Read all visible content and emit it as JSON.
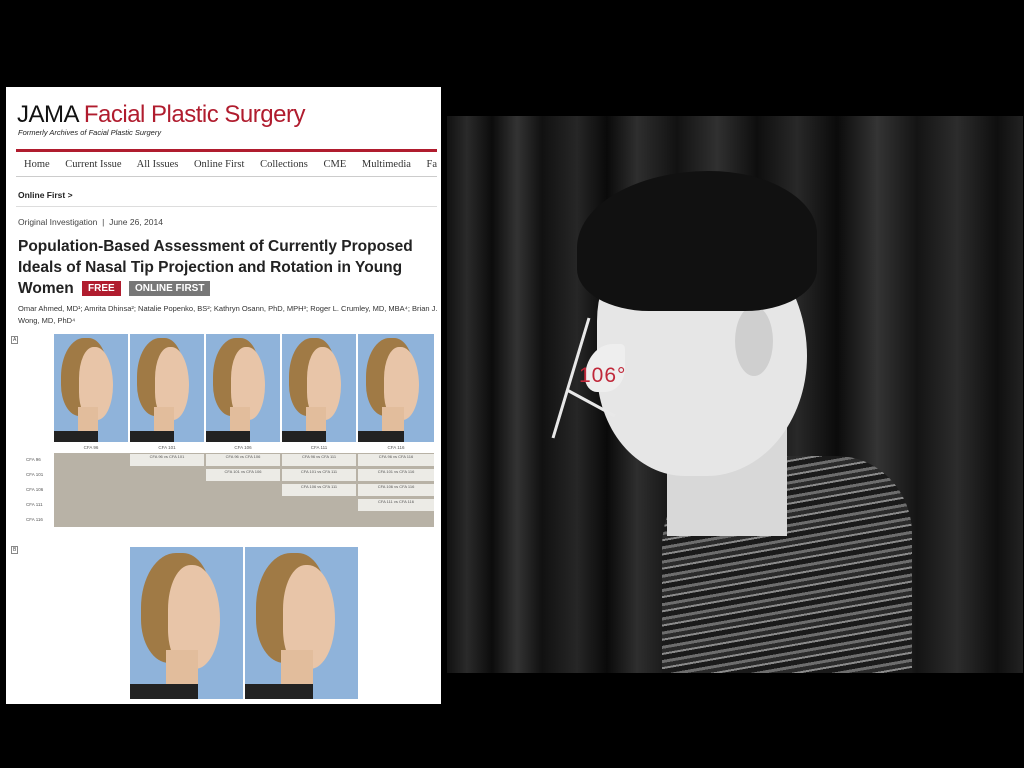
{
  "journal": {
    "brand": "JAMA",
    "name": "Facial Plastic Surgery",
    "subtitle": "Formerly Archives of Facial Plastic Surgery",
    "brand_color": "#b01c2e",
    "nav": [
      "Home",
      "Current Issue",
      "All Issues",
      "Online First",
      "Collections",
      "CME",
      "Multimedia",
      "Fa"
    ],
    "breadcrumb": "Online First >",
    "article_type": "Original Investigation",
    "date": "June 26, 2014",
    "title": "Population-Based Assessment of Currently Proposed Ideals of Nasal Tip Projection and Rotation in Young Women",
    "badges": {
      "free": "FREE",
      "online_first": "ONLINE FIRST"
    },
    "authors": "Omar Ahmed, MD¹; Amrita Dhinsa²; Natalie Popenko, BS²; Kathryn Osann, PhD, MPH³; Roger L. Crumley, MD, MBA⁴; Brian J. Wong, MD, PhD⁴"
  },
  "figure": {
    "panel_a_label": "A",
    "panel_b_label": "B",
    "cfa_labels": [
      "CFA 96",
      "CFA 101",
      "CFA 106",
      "CFA 111",
      "CFA 116"
    ],
    "row_labels": [
      "CFA 96",
      "CFA 101",
      "CFA 106",
      "CFA 111",
      "CFA 116"
    ],
    "cells": {
      "c1": "CFA 96 vs CFA 101",
      "c2": "CFA 96 vs CFA 106",
      "c3": "CFA 101 vs CFA 106",
      "c4": "CFA 96 vs CFA 111",
      "c5": "CFA 101 vs CFA 111",
      "c6": "CFA 106 vs CFA 111",
      "c7": "CFA 96 vs CFA 116",
      "c8": "CFA 101 vs CFA 116",
      "c9": "CFA 106 vs CFA 116",
      "c10": "CFA 111 vs CFA 116"
    }
  },
  "portrait": {
    "angle_label": "106°",
    "annotation_color": "#c0283a"
  }
}
